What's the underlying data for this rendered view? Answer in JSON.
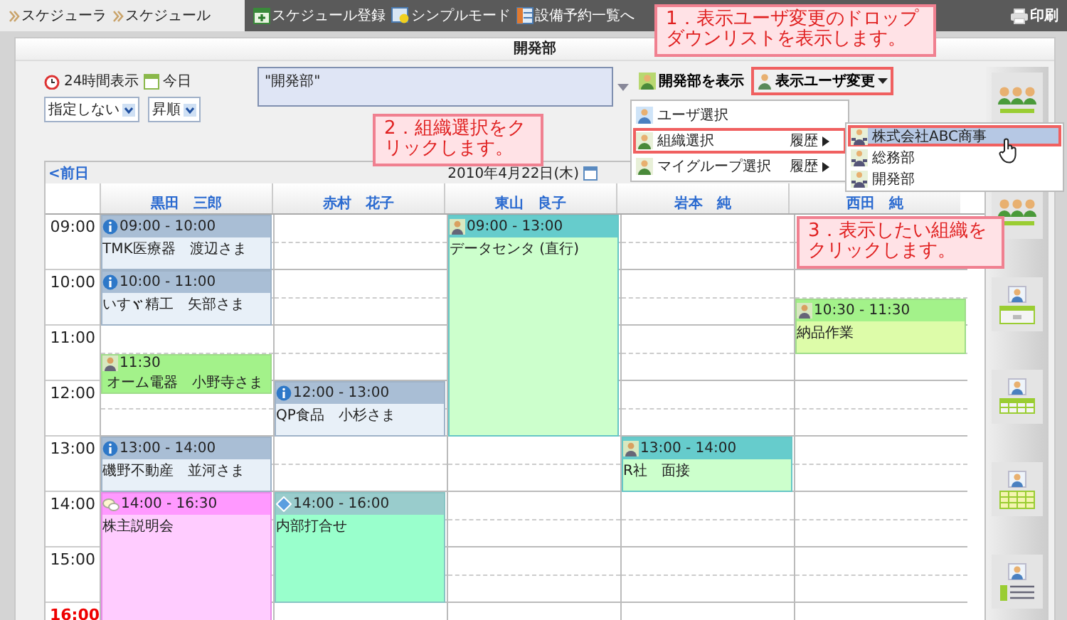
{
  "app_tabs": [
    "スケジューラ",
    "スケジュール"
  ],
  "menu": [
    {
      "label": "スケジュール登録",
      "kind": "add"
    },
    {
      "label": "シンプルモード",
      "kind": "simple"
    },
    {
      "label": "設備予約一覧へ",
      "kind": "facility"
    }
  ],
  "print_button": "印刷",
  "panel_title": "開発部",
  "options": {
    "hours_toggle": "24時間表示",
    "today_button": "今日",
    "filter": "指定しない",
    "order": "昇順"
  },
  "selected_groups": "\"開発部\"",
  "show_group_button": "開発部を表示",
  "change_user_button": "表示ユーザ変更",
  "dropdown": [
    {
      "label": "ユーザ選択",
      "selected": false
    },
    {
      "label": "組織選択",
      "history": "履歴",
      "selected": true
    },
    {
      "label": "マイグループ選択",
      "history": "履歴",
      "selected": false
    }
  ],
  "submenu": [
    {
      "label": "株式会社ABC商事",
      "selected": true
    },
    {
      "label": "総務部",
      "selected": false
    },
    {
      "label": "開発部",
      "selected": false
    }
  ],
  "calendar": {
    "prev_link": "<前日",
    "date": "2010年4月22日(木)",
    "hours": [
      {
        "label": "09:00",
        "alert": false
      },
      {
        "label": "10:00",
        "alert": false
      },
      {
        "label": "11:00",
        "alert": false
      },
      {
        "label": "12:00",
        "alert": false
      },
      {
        "label": "13:00",
        "alert": false
      },
      {
        "label": "14:00",
        "alert": false
      },
      {
        "label": "15:00",
        "alert": false
      },
      {
        "label": "16:00",
        "alert": true
      }
    ],
    "columns": [
      {
        "name": "黒田　三郎",
        "events": [
          {
            "kind": "visit",
            "time": "09:00 - 10:00",
            "title": "TMK医療器　渡辺さま"
          },
          {
            "kind": "visit",
            "time": "10:00 - 11:00",
            "title": "いすゞ精工　矢部さま"
          },
          {
            "kind": "task",
            "time": "11:30",
            "title": "オーム電器　小野寺さま"
          },
          {
            "kind": "visit",
            "time": "13:00 - 14:00",
            "title": "磯野不動産　並河さま"
          },
          {
            "kind": "event",
            "time": "14:00 - 16:30",
            "title": "株主説明会"
          }
        ]
      },
      {
        "name": "赤村　花子",
        "events": [
          {
            "kind": "visit",
            "time": "12:00 - 13:00",
            "title": "QP食品　小杉さま"
          },
          {
            "kind": "meeting",
            "time": "14:00 - 16:00",
            "title": "内部打合せ"
          }
        ]
      },
      {
        "name": "東山　良子",
        "events": [
          {
            "kind": "outing",
            "time": "09:00 - 13:00",
            "title": "データセンタ (直行)"
          }
        ]
      },
      {
        "name": "岩本　純",
        "events": [
          {
            "kind": "outing",
            "time": "13:00 - 14:00",
            "title": "R社　面接"
          }
        ]
      },
      {
        "name": "西田　純",
        "events": [
          {
            "kind": "task",
            "time": "10:30 - 11:30",
            "title": "納品作業"
          }
        ]
      }
    ]
  },
  "sidebar_views": [
    {
      "kind": "group"
    },
    {
      "kind": "group"
    },
    {
      "kind": "day"
    },
    {
      "kind": "week"
    },
    {
      "kind": "month"
    },
    {
      "kind": "list"
    }
  ],
  "callouts": [
    {
      "text": "1．表示ユーザ変更のドロップダウンリストを表示します。",
      "kind": "down"
    },
    {
      "text": "2．組織選択をクリックします。",
      "kind": "right"
    },
    {
      "text": "3．表示したい組織をクリックします。",
      "kind": "up"
    }
  ]
}
